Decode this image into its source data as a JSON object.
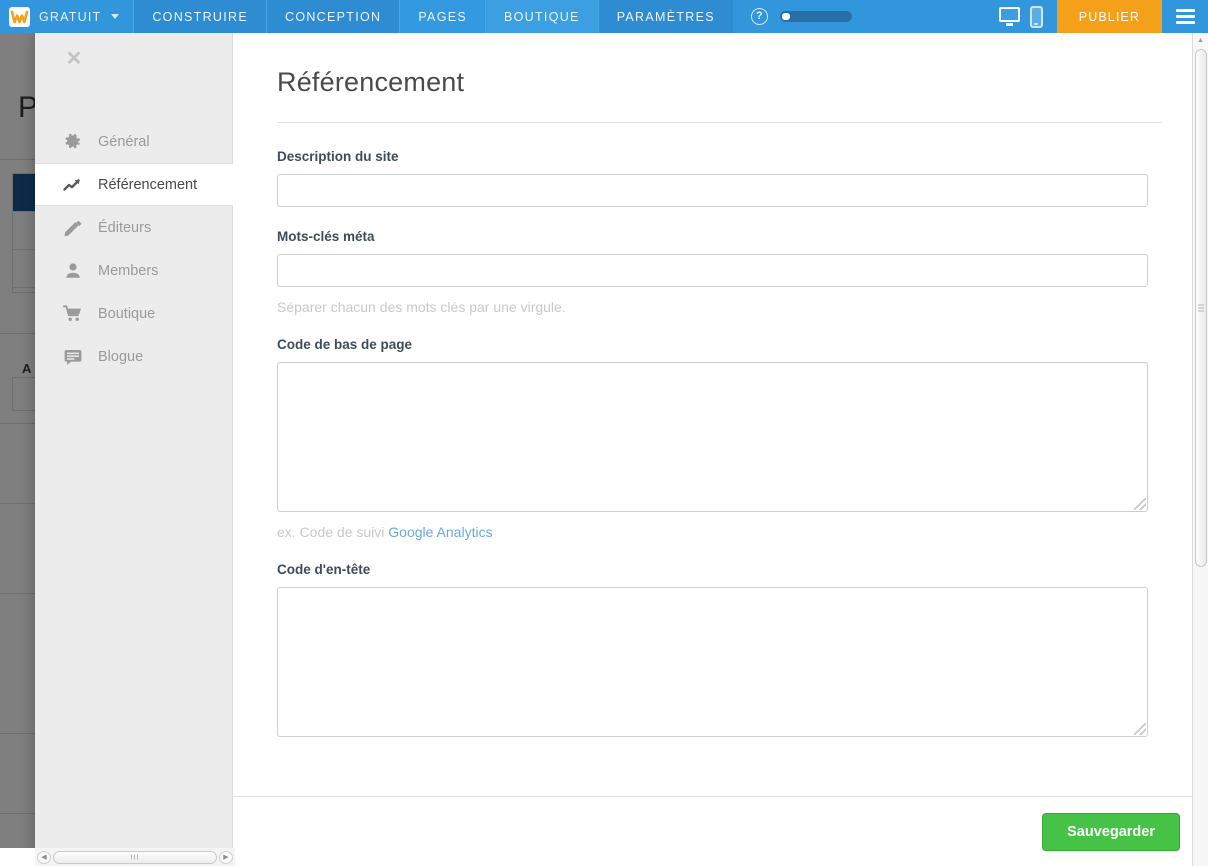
{
  "topbar": {
    "brand_label": "GRATUIT",
    "brand_icon": "weebly-w-logo",
    "caret_icon": "chevron-down-icon",
    "tabs": [
      {
        "label": "CONSTRUIRE",
        "name": "tab-construire"
      },
      {
        "label": "CONCEPTION",
        "name": "tab-conception"
      },
      {
        "label": "PAGES",
        "name": "tab-pages"
      },
      {
        "label": "BOUTIQUE",
        "name": "tab-boutique"
      },
      {
        "label": "PARAMÈTRES",
        "name": "tab-parametres"
      }
    ],
    "help_label": "?",
    "help_icon": "question-mark-icon",
    "desktop_icon": "desktop-monitor-icon",
    "mobile_icon": "mobile-phone-icon",
    "publish_label": "PUBLIER",
    "menu_icon": "hamburger-menu-icon"
  },
  "background_page": {
    "title": "P",
    "label": "A"
  },
  "modal": {
    "close_icon": "close-x-icon",
    "sidebar": {
      "items": [
        {
          "label": "Général",
          "icon": "gear-icon",
          "active": false
        },
        {
          "label": "Référencement",
          "icon": "trend-line-icon",
          "active": true
        },
        {
          "label": "Éditeurs",
          "icon": "pencil-icon",
          "active": false
        },
        {
          "label": "Members",
          "icon": "person-icon",
          "active": false
        },
        {
          "label": "Boutique",
          "icon": "shopping-cart-icon",
          "active": false
        },
        {
          "label": "Blogue",
          "icon": "comment-bubble-icon",
          "active": false
        }
      ]
    },
    "pane": {
      "title": "Référencement",
      "fields": [
        {
          "label": "Description du site",
          "type": "text",
          "value": "",
          "placeholder": "",
          "helper": ""
        },
        {
          "label": "Mots-clés méta",
          "type": "text",
          "value": "",
          "placeholder": "",
          "helper": "Séparer chacun des mots clés par une virgule."
        },
        {
          "label": "Code de bas de page",
          "type": "textarea",
          "value": "",
          "placeholder": "",
          "helper_prefix": "ex. Code de suivi ",
          "helper_link": "Google Analytics"
        },
        {
          "label": "Code d'en-tête",
          "type": "textarea",
          "value": "",
          "placeholder": "",
          "helper": ""
        }
      ]
    },
    "footer": {
      "save_label": "Sauvegarder"
    }
  },
  "scrollbars": {
    "v_up_icon": "triangle-up-icon",
    "v_down_icon": "triangle-down-icon",
    "h_left_icon": "triangle-left-icon",
    "h_right_icon": "triangle-right-icon"
  },
  "colors": {
    "toolbar_blue": "#3296dc",
    "publish_orange": "#f5a019",
    "save_green": "#46c346",
    "link_blue": "#6aa9e0",
    "modal_sidebar": "#ececec"
  }
}
